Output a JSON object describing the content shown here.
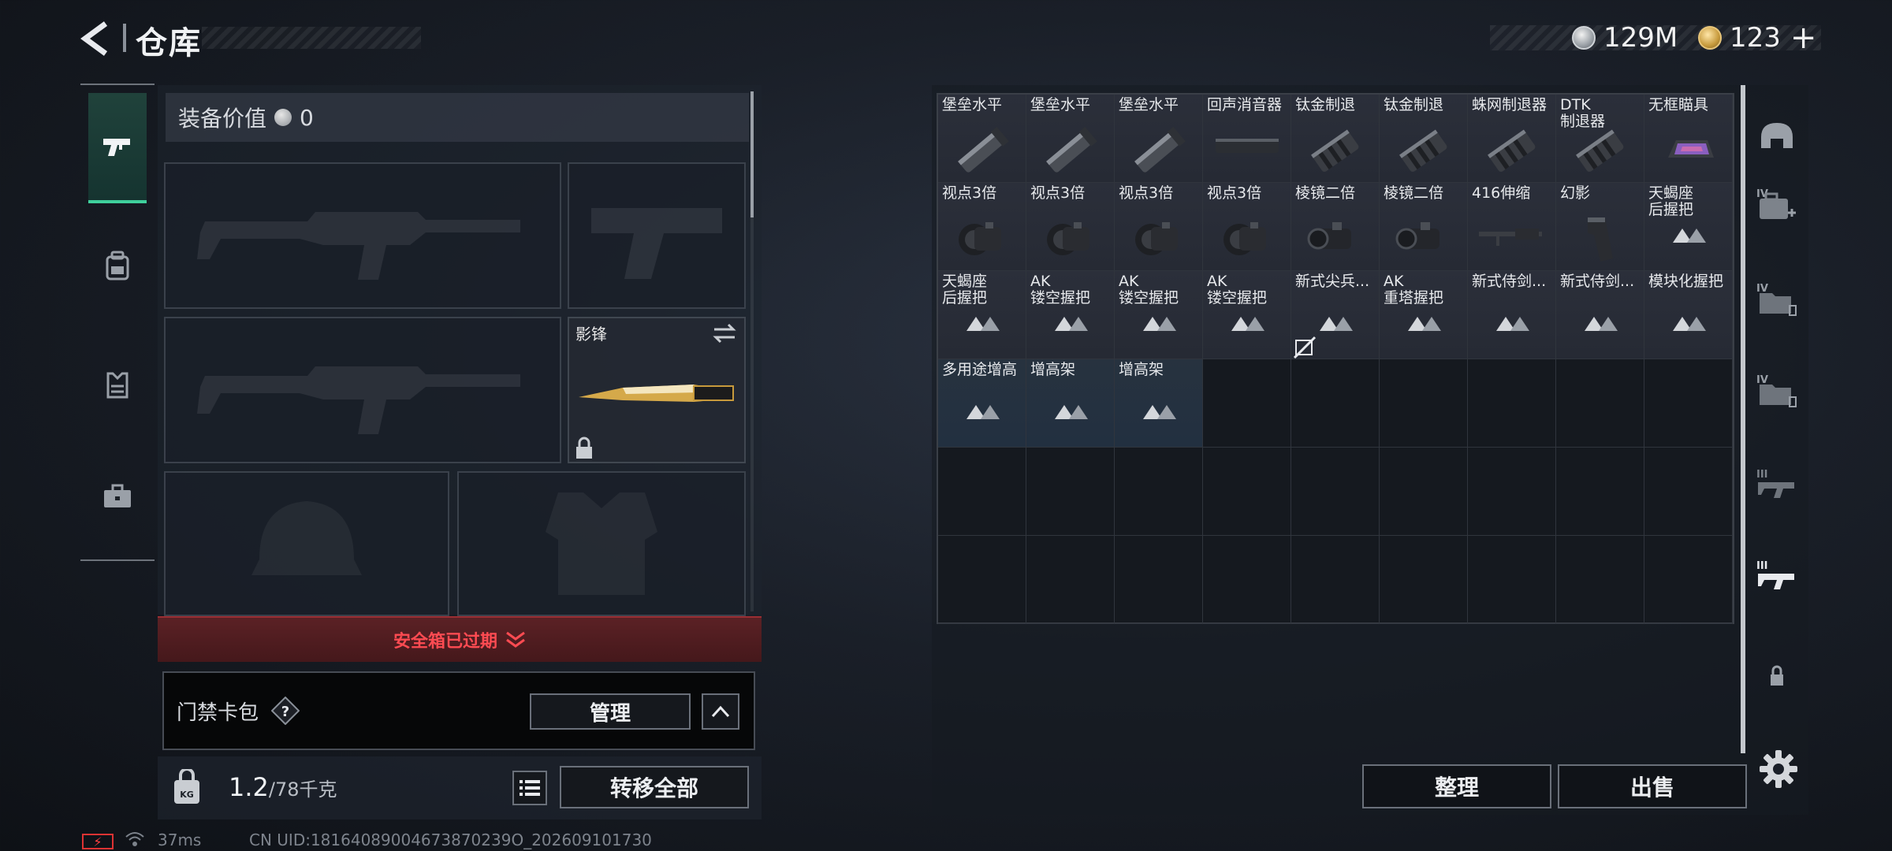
{
  "header": {
    "title": "仓库",
    "currency_silver": "129M",
    "currency_gold": "123",
    "gold_plus": "+"
  },
  "left_nav": {
    "items": [
      {
        "icon": "pistol-icon",
        "active": true
      },
      {
        "icon": "backpack-icon",
        "active": false
      },
      {
        "icon": "vest-icon",
        "active": false
      },
      {
        "icon": "toolbox-icon",
        "active": false
      }
    ]
  },
  "loadout": {
    "equip_value_label": "装备价值",
    "equip_value": "0",
    "knife_name": "影锋",
    "safe_box_text": "安全箱已过期",
    "card_pack_label": "门禁卡包",
    "help": "?",
    "manage_label": "管理",
    "weight_value": "1.2",
    "weight_capacity": "/78千克",
    "transfer_all_label": "转移全部"
  },
  "stash": {
    "items": [
      {
        "name": "堡垒水平",
        "icon": "muzzle-brake-icon"
      },
      {
        "name": "堡垒水平",
        "icon": "muzzle-brake-icon"
      },
      {
        "name": "堡垒水平",
        "icon": "muzzle-brake-icon"
      },
      {
        "name": "回声消音器",
        "icon": "suppressor-icon"
      },
      {
        "name": "钛金制退",
        "icon": "compensator-icon"
      },
      {
        "name": "钛金制退",
        "icon": "compensator-icon"
      },
      {
        "name": "蛛网制退器",
        "icon": "compensator-icon"
      },
      {
        "name": "DTK\n制退器",
        "icon": "compensator-icon"
      },
      {
        "name": "无框瞄具",
        "icon": "holo-sight-icon"
      },
      {
        "name": "视点3倍",
        "icon": "scope-icon"
      },
      {
        "name": "视点3倍",
        "icon": "scope-icon"
      },
      {
        "name": "视点3倍",
        "icon": "scope-icon"
      },
      {
        "name": "视点3倍",
        "icon": "scope-icon"
      },
      {
        "name": "棱镜二倍",
        "icon": "prism-scope-icon"
      },
      {
        "name": "棱镜二倍",
        "icon": "prism-scope-icon"
      },
      {
        "name": "416伸缩",
        "icon": "stock-icon"
      },
      {
        "name": "幻影",
        "icon": "grip-icon"
      },
      {
        "name": "天蝎座\n后握把",
        "icon": "mountain-placeholder-icon"
      },
      {
        "name": "天蝎座\n后握把",
        "icon": "mountain-placeholder-icon"
      },
      {
        "name": "AK\n镂空握把",
        "icon": "mountain-placeholder-icon"
      },
      {
        "name": "AK\n镂空握把",
        "icon": "mountain-placeholder-icon"
      },
      {
        "name": "AK\n镂空握把",
        "icon": "mountain-placeholder-icon"
      },
      {
        "name": "新式尖兵...",
        "icon": "mountain-placeholder-icon"
      },
      {
        "name": "AK\n重塔握把",
        "icon": "mountain-placeholder-icon"
      },
      {
        "name": "新式侍剑...",
        "icon": "mountain-placeholder-icon"
      },
      {
        "name": "新式侍剑...",
        "icon": "mountain-placeholder-icon"
      },
      {
        "name": "模块化握把",
        "icon": "mountain-placeholder-icon"
      },
      {
        "name": "多用途增高",
        "icon": "mountain-placeholder-icon"
      },
      {
        "name": "增高架",
        "icon": "mountain-placeholder-icon"
      },
      {
        "name": "增高架",
        "icon": "mountain-placeholder-icon"
      }
    ],
    "sort_label": "整理",
    "sell_label": "出售"
  },
  "right_rail": [
    {
      "icon": "helmet-category-icon"
    },
    {
      "icon": "medkit-category-icon",
      "tier": "IV"
    },
    {
      "icon": "folder-category-icon",
      "tier": "IV"
    },
    {
      "icon": "folder-category-icon",
      "tier": "IV"
    },
    {
      "icon": "rifle-category-icon",
      "tier": "III"
    },
    {
      "icon": "rifle-category-icon",
      "tier": "III"
    },
    {
      "icon": "lock-icon"
    }
  ],
  "status_bar": {
    "ping": "37ms",
    "uid": "CN UID:18164089004673870239O_202609101730"
  }
}
